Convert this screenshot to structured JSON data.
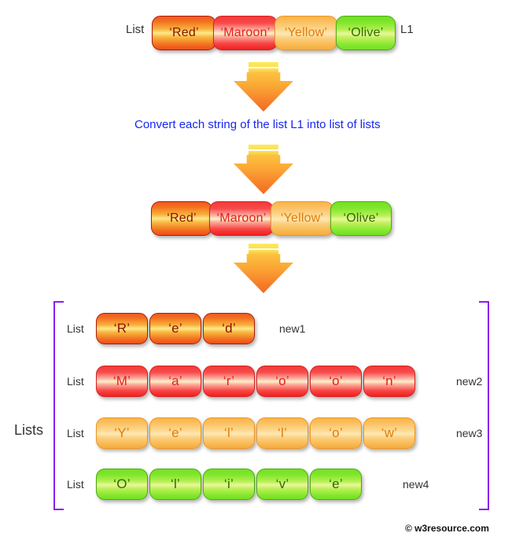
{
  "diagram": {
    "title_caption": "Convert each string of the list L1 into list of lists",
    "credit": "© w3resource.com",
    "colors": {
      "caption": "#1726f0",
      "bracket": "#8a1df0",
      "arrow": "#f7862c",
      "red": "#f05a22",
      "maroon": "#f33a3a",
      "yellow": "#f9b44a",
      "green": "#75e022"
    }
  },
  "source_list": {
    "left_label": "List",
    "right_label": "L1",
    "items": [
      {
        "text": "‘Red’",
        "color": "red"
      },
      {
        "text": "‘Maroon’",
        "color": "maroon"
      },
      {
        "text": "‘Yellow’",
        "color": "yellow"
      },
      {
        "text": "‘Olive’",
        "color": "green"
      }
    ]
  },
  "middle_list": {
    "items": [
      {
        "text": "‘Red’",
        "color": "red"
      },
      {
        "text": "‘Maroon’",
        "color": "maroon"
      },
      {
        "text": "‘Yellow’",
        "color": "yellow"
      },
      {
        "text": "‘Olive’",
        "color": "green"
      }
    ]
  },
  "result": {
    "group_label": "Lists",
    "rows": [
      {
        "left_label": "List",
        "right_label": "new1",
        "color": "red",
        "chars": [
          "‘R’",
          "‘e’",
          "‘d’"
        ]
      },
      {
        "left_label": "List",
        "right_label": "new2",
        "color": "maroon",
        "chars": [
          "‘M’",
          "‘a’",
          "‘r’",
          "‘o’",
          "‘o’",
          "‘n’"
        ]
      },
      {
        "left_label": "List",
        "right_label": "new3",
        "color": "yellow",
        "chars": [
          "‘Y’",
          "‘e’",
          "‘l’",
          "‘l’",
          "‘o’",
          "‘w’"
        ]
      },
      {
        "left_label": "List",
        "right_label": "new4",
        "color": "green",
        "chars": [
          "‘O’",
          "‘l’",
          "‘i’",
          "‘v’",
          "‘e’"
        ]
      }
    ]
  },
  "arrows": [
    {
      "name": "arrow-1"
    },
    {
      "name": "arrow-2"
    },
    {
      "name": "arrow-3"
    }
  ]
}
